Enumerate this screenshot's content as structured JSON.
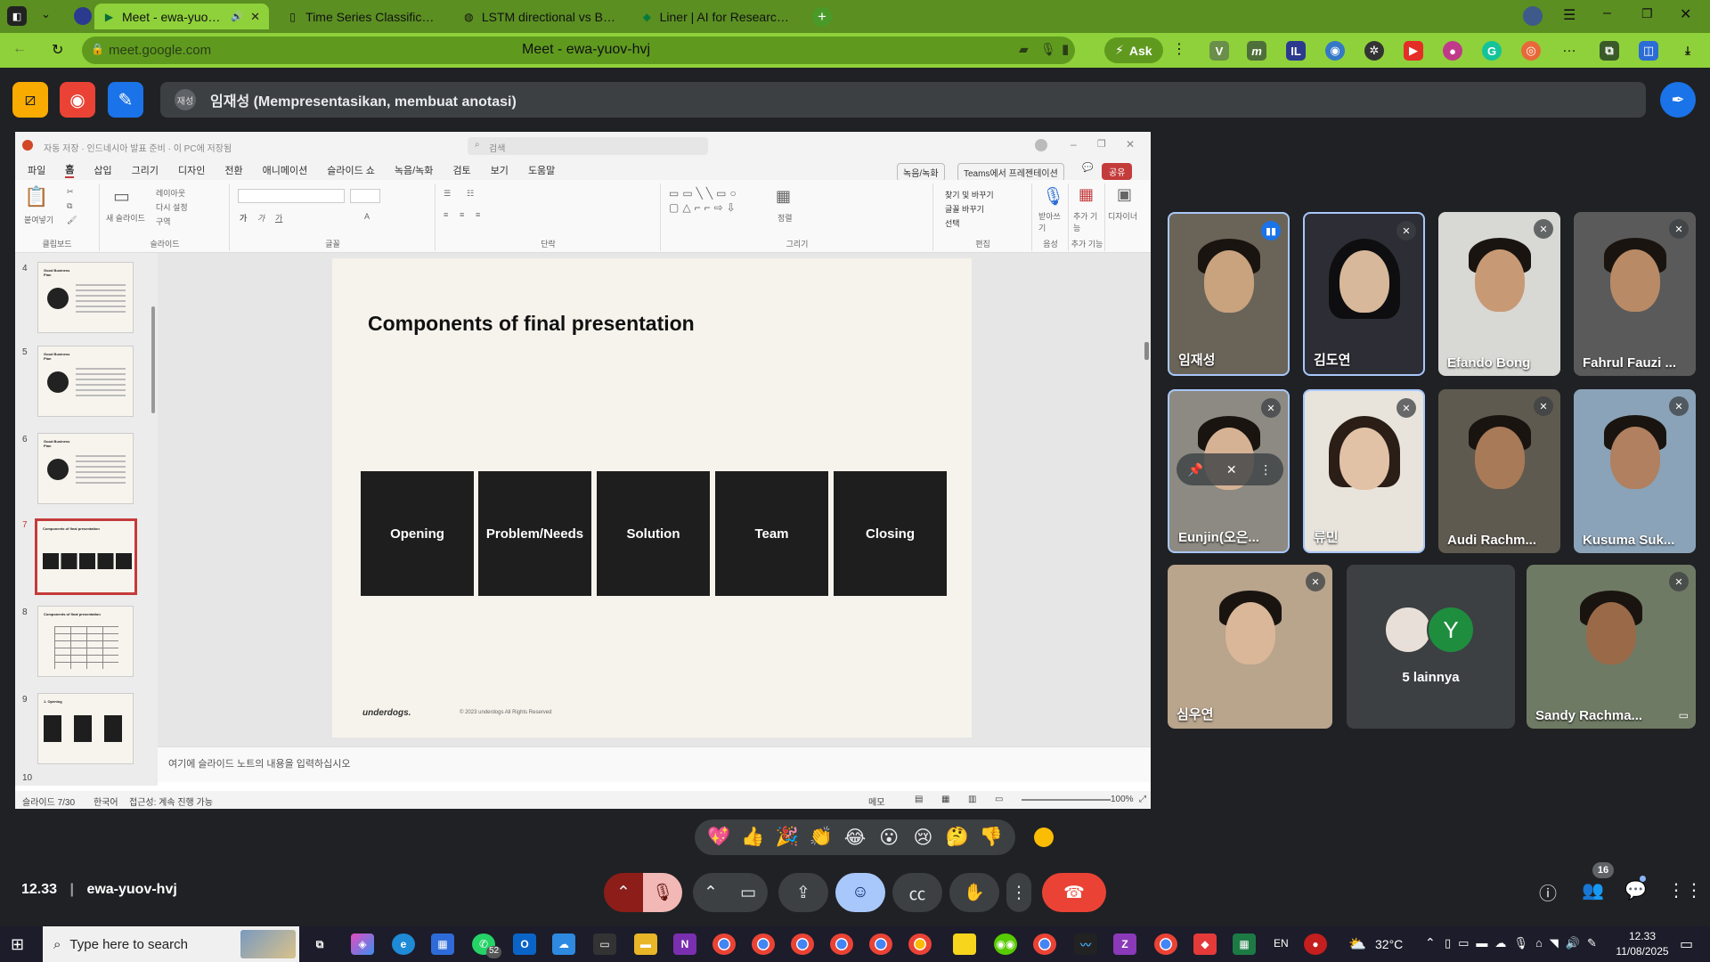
{
  "browser": {
    "tabs": [
      {
        "label": "Meet - ewa-yuov-hvj",
        "active": true
      },
      {
        "label": "Time Series Classification"
      },
      {
        "label": "LSTM directional vs BiLST"
      },
      {
        "label": "Liner | AI for Research with"
      }
    ],
    "url": "meet.google.com",
    "page_title": "Meet - ewa-yuov-hvj",
    "ask_label": "Ask"
  },
  "meet": {
    "presenter_initials": "재성",
    "presenter_text": "임재성 (Mempresentasikan, membuat anotasi)",
    "meeting_code": "ewa-yuov-hvj",
    "time": "12.33",
    "participants_count": "16",
    "others_count_label": "5 lainnya",
    "others_avatar_letter": "Y",
    "participants": [
      {
        "name": "임재성",
        "speaking": true
      },
      {
        "name": "김도연"
      },
      {
        "name": "Efando Bong"
      },
      {
        "name": "Fahrul Fauzi ..."
      },
      {
        "name": "Eunjin(오은..."
      },
      {
        "name": "류민"
      },
      {
        "name": "Audi Rachm..."
      },
      {
        "name": "Kusuma Suk..."
      },
      {
        "name": "심우연"
      },
      {
        "name": "Sandy Rachma..."
      }
    ],
    "reactions": [
      "💖",
      "👍",
      "🎉",
      "👏",
      "😂",
      "😮",
      "😢",
      "🤔",
      "👎"
    ]
  },
  "ppt": {
    "title": "자동 저장 · 인드네시아 발표 준비 · 이 PC에 저장됨",
    "search_placeholder": "검색",
    "menu": [
      "파일",
      "홈",
      "삽입",
      "그리기",
      "디자인",
      "전환",
      "애니메이션",
      "슬라이드 쇼",
      "녹음/녹화",
      "검토",
      "보기",
      "도움말"
    ],
    "record_btn": "녹음/녹화",
    "teams_btn": "Teams에서 프레젠테이션",
    "share_btn": "공유",
    "ribbon_groups": [
      "클립보드",
      "슬라이드",
      "글꼴",
      "단락",
      "그리기",
      "편집",
      "음성",
      "추가 기능"
    ],
    "ribbon_buttons": {
      "paste": "붙여넣기",
      "new_slide": "새 슬라이드",
      "layout": "레이아웃",
      "reset": "다시 설정",
      "section": "구역",
      "arrange": "정렬",
      "find_replace": "찾기 및 바꾸기",
      "replace_font": "글꼴 바꾸기",
      "select": "선택",
      "dictate": "받아쓰기",
      "addins": "추가 기능",
      "designer": "디자이너"
    },
    "thumbnail_numbers": [
      "4",
      "5",
      "6",
      "7",
      "8",
      "9",
      "10"
    ],
    "thumb_captions": [
      "Good Business Plan",
      "Good Business Plan",
      "Good Business Plan",
      "Components of final presentation",
      "Components of final presentation",
      "1. Opening"
    ],
    "slide": {
      "heading": "Components of final presentation",
      "cards": [
        "Opening",
        "Problem/Needs",
        "Solution",
        "Team",
        "Closing"
      ],
      "logo": "underdogs.",
      "copyright": "© 2023 underdogs All Rights Reserved"
    },
    "notes_placeholder": "여기에 슬라이드 노트의 내용을 입력하십시오",
    "status": {
      "slide_count": "슬라이드 7/30",
      "language": "한국어",
      "accessibility": "접근성: 계속 진행 가능",
      "notes_btn": "메모",
      "zoom": "100%"
    }
  },
  "taskbar": {
    "search_placeholder": "Type here to search",
    "whatsapp_badge": "52",
    "lang": "EN",
    "weather": "32°C",
    "time": "12.33",
    "date": "11/08/2025"
  }
}
